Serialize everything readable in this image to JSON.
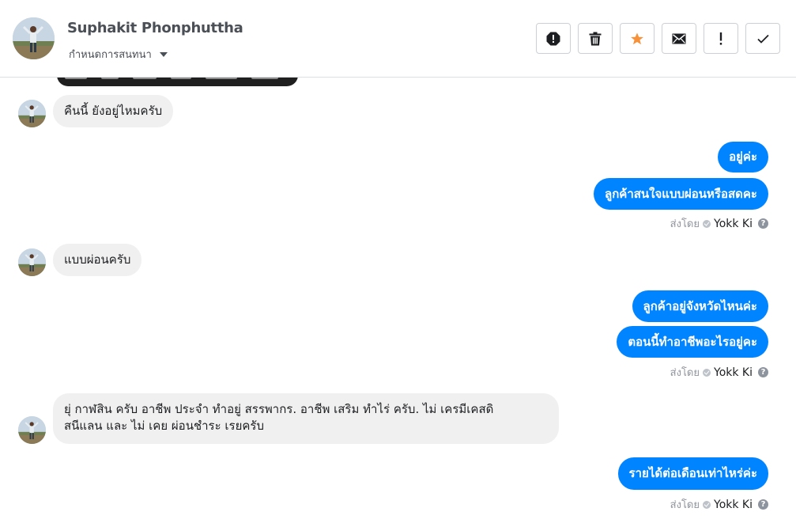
{
  "header": {
    "contact_name": "Suphakit Phonphuttha",
    "assign_label": "กำหนดการสนทนา",
    "actions": [
      {
        "name": "mark-spam",
        "icon": "alert-octagon-icon"
      },
      {
        "name": "delete",
        "icon": "trash-icon"
      },
      {
        "name": "star",
        "icon": "star-icon",
        "color": "#f7923b"
      },
      {
        "name": "mark-unread",
        "icon": "envelope-icon"
      },
      {
        "name": "follow-up",
        "icon": "exclamation-icon"
      },
      {
        "name": "mark-done",
        "icon": "checkmark-icon"
      }
    ]
  },
  "colors": {
    "outgoing_bubble": "#0084ff",
    "incoming_bubble": "#f1f0f0",
    "star": "#f7923b"
  },
  "messages": {
    "m1": "คืนนี้ ยังอยู่ไหมครับ",
    "m2": "อยู่ค่ะ",
    "m3": "ลูกค้าสนใจแบบผ่อนหรือสดคะ",
    "m4": "แบบผ่อนครับ",
    "m5": "ลูกค้าอยู่จังหวัดไหนค่ะ",
    "m6": "ตอนนี้ทำอาชีพอะไรอยู่คะ",
    "m7_line1": "ยุ่ กาฬสิน ครับ  อาชีพ ประจำ ทำอยู่ สรรพากร. อาชีพ เสริม ทำไร่ ครับ.  ไม่ เครมีเคสดิ",
    "m7_line2": "สนีแลน และ ไม่ เคย ผ่อนชำระ เรยครับ",
    "m8": "รายได้ต่อเดือนเท่าไหร่ค่ะ"
  },
  "sent_by": {
    "label": "ส่งโดย",
    "agent": "Yokk Ki",
    "help": "?"
  }
}
